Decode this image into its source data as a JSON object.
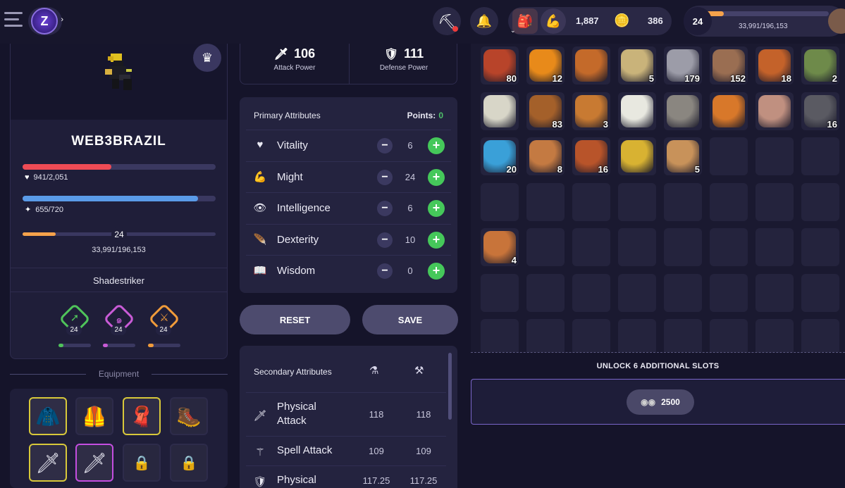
{
  "header": {
    "currency": {
      "primary": "1,887",
      "secondary": "386"
    },
    "level": {
      "value": "24",
      "xp_text": "33,991/196,153",
      "xp_progress": 0.17
    }
  },
  "character": {
    "name": "WEB3BRAZIL",
    "health": {
      "text": "941/2,051",
      "progress": 0.46,
      "color": "#ee4b55"
    },
    "mana": {
      "text": "655/720",
      "progress": 0.91,
      "color": "#5a9be8"
    },
    "xp": {
      "level": "24",
      "text": "33,991/196,153",
      "progress": 0.17,
      "color": "#f5a24b"
    },
    "class_name": "Shadestriker",
    "skills": [
      {
        "level": "24",
        "color": "#4fc35a",
        "progress": 0.15
      },
      {
        "level": "24",
        "color": "#c85bd6",
        "progress": 0.15
      },
      {
        "level": "24",
        "color": "#f09b3a",
        "progress": 0.18
      }
    ]
  },
  "equipment": {
    "label": "Equipment",
    "slots": [
      {
        "icon": "hood-icon",
        "glyph": "🧥",
        "rarity": "yellow"
      },
      {
        "icon": "armor-icon",
        "glyph": "🦺",
        "rarity": "none"
      },
      {
        "icon": "cloak-icon",
        "glyph": "🧣",
        "rarity": "yellow"
      },
      {
        "icon": "boot-icon",
        "glyph": "🥾",
        "rarity": "none"
      },
      {
        "icon": "dagger-icon",
        "glyph": "🗡",
        "rarity": "yellow"
      },
      {
        "icon": "dagger-icon",
        "glyph": "🗡",
        "rarity": "purple"
      },
      {
        "icon": "lock-icon",
        "glyph": "🔒",
        "rarity": "locked"
      },
      {
        "icon": "lock-icon",
        "glyph": "🔒",
        "rarity": "locked"
      }
    ]
  },
  "power": {
    "attack": {
      "value": "106",
      "label": "Attack Power"
    },
    "defense": {
      "value": "111",
      "label": "Defense Power"
    }
  },
  "primary": {
    "title": "Primary Attributes",
    "points_label": "Points:",
    "points": "0",
    "attributes": [
      {
        "name": "Vitality",
        "value": "6",
        "icon": "heart-icon",
        "glyph": "♥"
      },
      {
        "name": "Might",
        "value": "24",
        "icon": "muscle-icon",
        "glyph": "💪"
      },
      {
        "name": "Intelligence",
        "value": "6",
        "icon": "eye-icon",
        "glyph": "👁"
      },
      {
        "name": "Dexterity",
        "value": "10",
        "icon": "feather-icon",
        "glyph": "🪶"
      },
      {
        "name": "Wisdom",
        "value": "0",
        "icon": "book-icon",
        "glyph": "📖"
      }
    ]
  },
  "buttons": {
    "reset": "RESET",
    "save": "SAVE"
  },
  "secondary": {
    "title": "Secondary Attributes",
    "rows": [
      {
        "name_line1": "Physical",
        "name_line2": "Attack",
        "base": "118",
        "total": "118",
        "icon": "knife-icon"
      },
      {
        "name_line1": "Spell Attack",
        "name_line2": "",
        "base": "109",
        "total": "109",
        "icon": "staff-icon"
      },
      {
        "name_line1": "Physical",
        "name_line2": "",
        "base": "117.25",
        "total": "117.25",
        "icon": "shield-icon"
      }
    ]
  },
  "inventory": {
    "items": [
      {
        "icon": "banner-icon",
        "qty": "80",
        "color": "#b8442a"
      },
      {
        "icon": "amber-icon",
        "qty": "12",
        "color": "#e88a1a"
      },
      {
        "icon": "log-icon",
        "qty": "",
        "color": "#c46a2a"
      },
      {
        "icon": "wheat-icon",
        "qty": "5",
        "color": "#c9b37a"
      },
      {
        "icon": "stone-icon",
        "qty": "179",
        "color": "#9c9ca8"
      },
      {
        "icon": "pot-icon",
        "qty": "152",
        "color": "#9a6e52"
      },
      {
        "icon": "meat-icon",
        "qty": "18",
        "color": "#c4622a"
      },
      {
        "icon": "claw-icon",
        "qty": "2",
        "color": "#6e8a4a"
      },
      {
        "icon": "dagger-icon",
        "qty": "",
        "color": "#d8d6c8"
      },
      {
        "icon": "plank-icon",
        "qty": "83",
        "color": "#a4602a"
      },
      {
        "icon": "barrel-icon",
        "qty": "3",
        "color": "#c87a32"
      },
      {
        "icon": "cotton-icon",
        "qty": "",
        "color": "#e8e8e0"
      },
      {
        "icon": "rock-icon",
        "qty": "",
        "color": "#8a8680"
      },
      {
        "icon": "ingot-icon",
        "qty": "",
        "color": "#d8782a"
      },
      {
        "icon": "ore-icon",
        "qty": "",
        "color": "#c09080"
      },
      {
        "icon": "coal-icon",
        "qty": "16",
        "color": "#5a5a62"
      },
      {
        "icon": "potion-icon",
        "qty": "20",
        "color": "#3aa0d8"
      },
      {
        "icon": "hide-icon",
        "qty": "8",
        "color": "#c47a42"
      },
      {
        "icon": "mushroom-icon",
        "qty": "16",
        "color": "#b8542a"
      },
      {
        "icon": "cloth-icon",
        "qty": "",
        "color": "#d8b232"
      },
      {
        "icon": "yarn-icon",
        "qty": "5",
        "color": "#c8925a"
      },
      {
        "icon": "",
        "qty": "",
        "color": ""
      },
      {
        "icon": "",
        "qty": "",
        "color": ""
      },
      {
        "icon": "",
        "qty": "",
        "color": ""
      },
      {
        "icon": "",
        "qty": "",
        "color": ""
      },
      {
        "icon": "",
        "qty": "",
        "color": ""
      },
      {
        "icon": "",
        "qty": "",
        "color": ""
      },
      {
        "icon": "",
        "qty": "",
        "color": ""
      },
      {
        "icon": "",
        "qty": "",
        "color": ""
      },
      {
        "icon": "",
        "qty": "",
        "color": ""
      },
      {
        "icon": "",
        "qty": "",
        "color": ""
      },
      {
        "icon": "",
        "qty": "",
        "color": ""
      },
      {
        "icon": "leather-icon",
        "qty": "4",
        "color": "#c8743a"
      }
    ]
  },
  "unlock": {
    "title": "UNLOCK 6 ADDITIONAL SLOTS",
    "cost": "2500"
  }
}
